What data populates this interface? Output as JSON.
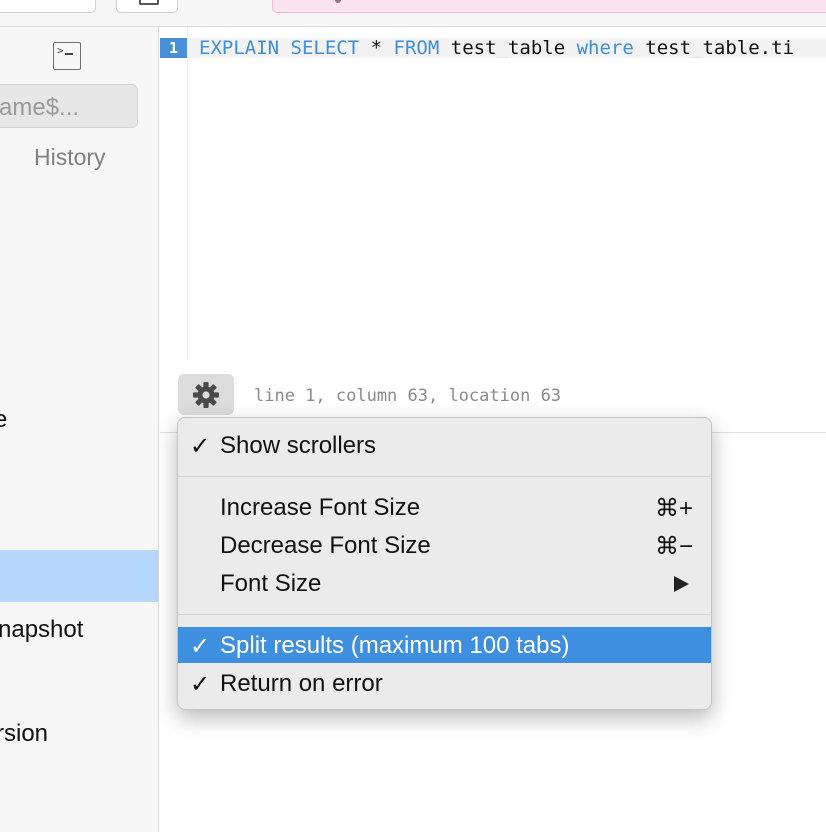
{
  "sidebar": {
    "search_value": "ame$...",
    "history_label": "History",
    "items": [
      {
        "label": "e"
      },
      {
        "label": ""
      },
      {
        "label": "napshot"
      },
      {
        "label": "rsion"
      }
    ]
  },
  "editor": {
    "line_number": "1",
    "tokens": [
      "EXPLAIN",
      "SELECT",
      "*",
      "FROM",
      "test_table",
      "where",
      "test_table.ti"
    ]
  },
  "status": {
    "text": "line 1, column 63, location 63"
  },
  "menu": {
    "items": [
      {
        "check": "✓",
        "label": "Show scrollers",
        "shortcut": ""
      },
      {
        "check": "",
        "label": "Increase Font Size",
        "shortcut": "⌘+"
      },
      {
        "check": "",
        "label": "Decrease Font Size",
        "shortcut": "⌘−"
      },
      {
        "check": "",
        "label": "Font Size",
        "shortcut": ""
      },
      {
        "check": "✓",
        "label": "Split results (maximum 100 tabs)",
        "shortcut": ""
      },
      {
        "check": "✓",
        "label": "Return on error",
        "shortcut": ""
      }
    ]
  },
  "colors": {
    "keyword": "#3f8fd6",
    "line_number_bg": "#4a90d9",
    "menu_highlight": "#3f8fe0",
    "selection_row": "#b4d7fb"
  },
  "icons": {
    "console": "console-icon",
    "gear": "gear-icon",
    "submenu": "triangle-right-icon"
  }
}
